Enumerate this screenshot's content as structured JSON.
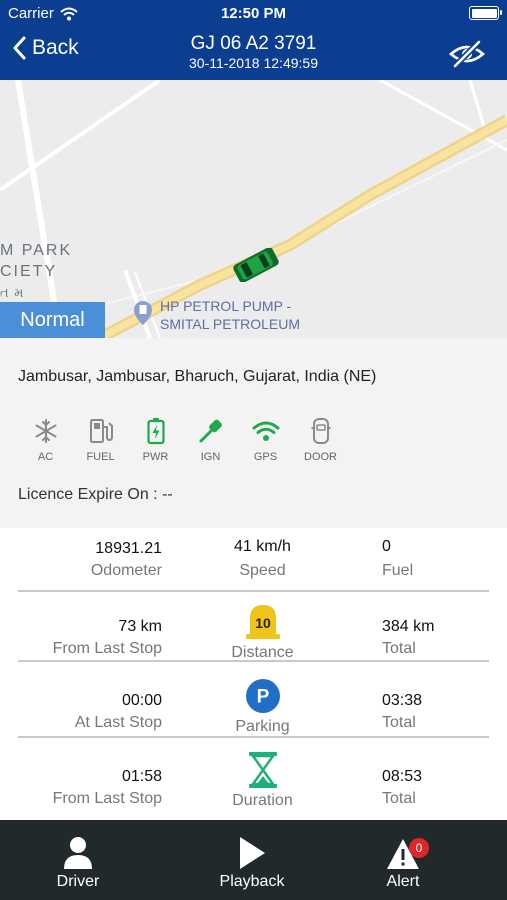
{
  "statusbar": {
    "carrier": "Carrier",
    "time": "12:50 PM"
  },
  "navbar": {
    "back_label": "Back",
    "title": "GJ 06 A2 3791",
    "subtitle": "30-11-2018 12:49:59"
  },
  "map": {
    "area_label_line1": "M PARK",
    "area_label_line2": "CIETY",
    "area_label_line3": "ત મ",
    "poi_line1": "HP PETROL PUMP -",
    "poi_line2": "SMITAL PETROLEUM",
    "status": "Normal"
  },
  "info": {
    "address": "Jambusar, Jambusar, Bharuch, Gujarat, India (NE)",
    "sensors": [
      {
        "label": "AC",
        "icon": "snowflake-icon",
        "color": "#8a8a8a"
      },
      {
        "label": "FUEL",
        "icon": "fuel-pump-icon",
        "color": "#8a8a8a"
      },
      {
        "label": "PWR",
        "icon": "battery-icon",
        "color": "#1faa4a"
      },
      {
        "label": "IGN",
        "icon": "key-icon",
        "color": "#1faa4a"
      },
      {
        "label": "GPS",
        "icon": "wifi-signal-icon",
        "color": "#1faa4a"
      },
      {
        "label": "DOOR",
        "icon": "car-door-icon",
        "color": "#8a8a8a"
      }
    ],
    "licence": "Licence Expire On : --"
  },
  "stats": {
    "row1": {
      "left_value": "18931.21",
      "left_label": "Odometer",
      "mid_value": "41 km/h",
      "mid_label": "Speed",
      "right_value": "0",
      "right_label": "Fuel"
    },
    "row2": {
      "left_value": "73 km",
      "left_label": "From Last Stop",
      "mid_badge": "10",
      "mid_label": "Distance",
      "right_value": "384 km",
      "right_label": "Total"
    },
    "row3": {
      "left_value": "00:00",
      "left_label": "At Last Stop",
      "mid_badge": "P",
      "mid_label": "Parking",
      "right_value": "03:38",
      "right_label": "Total"
    },
    "row4": {
      "left_value": "01:58",
      "left_label": "From Last Stop",
      "mid_label": "Duration",
      "right_value": "08:53",
      "right_label": "Total"
    }
  },
  "tabbar": {
    "driver": "Driver",
    "playback": "Playback",
    "alert": "Alert",
    "alert_count": "0"
  },
  "colors": {
    "nav": "#0b3d91",
    "accent_green": "#1faa4a",
    "distance_yellow": "#f0c419",
    "parking_blue": "#1f6fc9",
    "tabbar": "#21292b",
    "badge_red": "#e0262b"
  }
}
